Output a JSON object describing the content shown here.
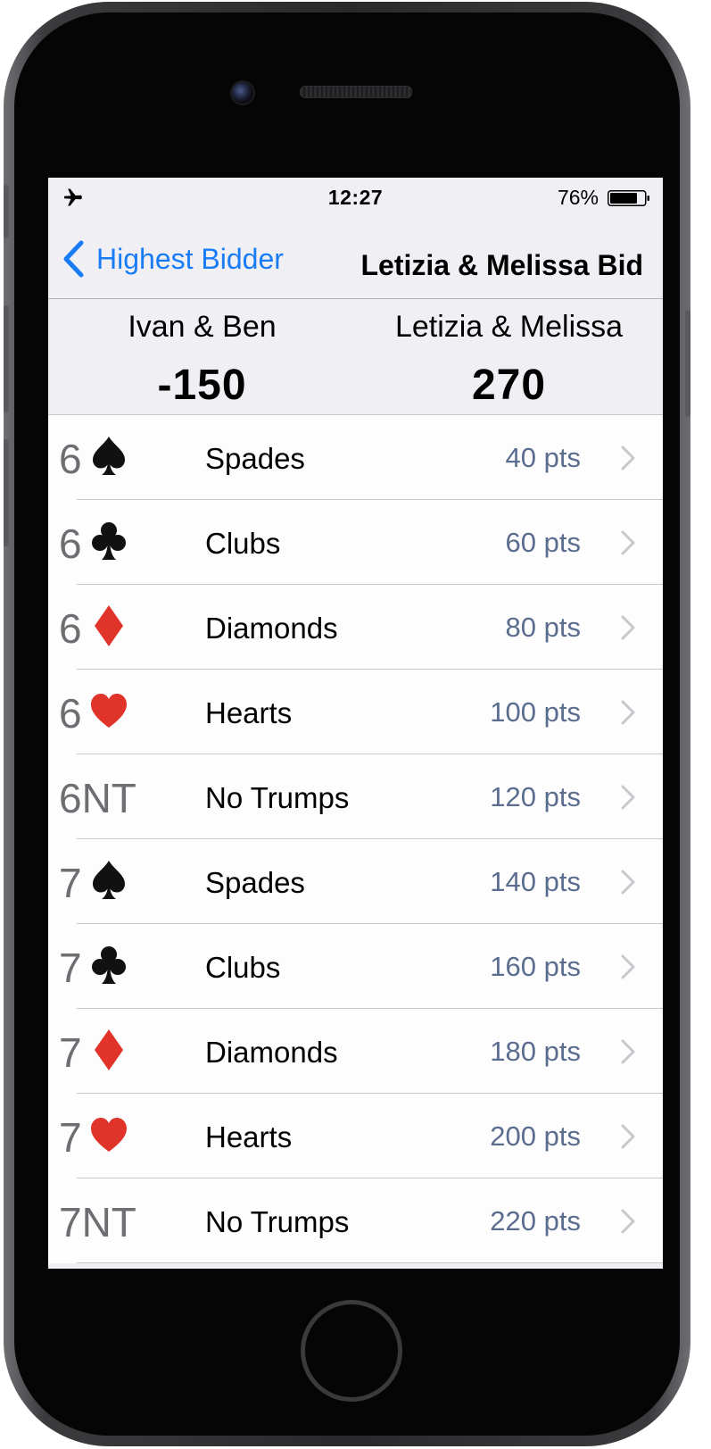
{
  "status_bar": {
    "time": "12:27",
    "battery": "76%"
  },
  "nav": {
    "back_label": "Highest Bidder",
    "title": "Letizia & Melissa Bid"
  },
  "teams": [
    {
      "name": "Ivan & Ben",
      "score": "-150"
    },
    {
      "name": "Letizia & Melissa",
      "score": "270"
    }
  ],
  "bids": [
    {
      "level": "6",
      "suit_icon": "spade-icon",
      "suit": "Spades",
      "points": "40 pts"
    },
    {
      "level": "6",
      "suit_icon": "club-icon",
      "suit": "Clubs",
      "points": "60 pts"
    },
    {
      "level": "6",
      "suit_icon": "diamond-icon",
      "suit": "Diamonds",
      "points": "80 pts"
    },
    {
      "level": "6",
      "suit_icon": "heart-icon",
      "suit": "Hearts",
      "points": "100 pts"
    },
    {
      "level": "6NT",
      "suit_icon": "",
      "suit": "No Trumps",
      "points": "120 pts"
    },
    {
      "level": "7",
      "suit_icon": "spade-icon",
      "suit": "Spades",
      "points": "140 pts"
    },
    {
      "level": "7",
      "suit_icon": "club-icon",
      "suit": "Clubs",
      "points": "160 pts"
    },
    {
      "level": "7",
      "suit_icon": "diamond-icon",
      "suit": "Diamonds",
      "points": "180 pts"
    },
    {
      "level": "7",
      "suit_icon": "heart-icon",
      "suit": "Hearts",
      "points": "200 pts"
    },
    {
      "level": "7NT",
      "suit_icon": "",
      "suit": "No Trumps",
      "points": "220 pts"
    }
  ],
  "colors": {
    "accent": "#1a7cf5",
    "points": "#5b6d8e",
    "red_suit": "#e0342b",
    "black_suit": "#111111"
  }
}
